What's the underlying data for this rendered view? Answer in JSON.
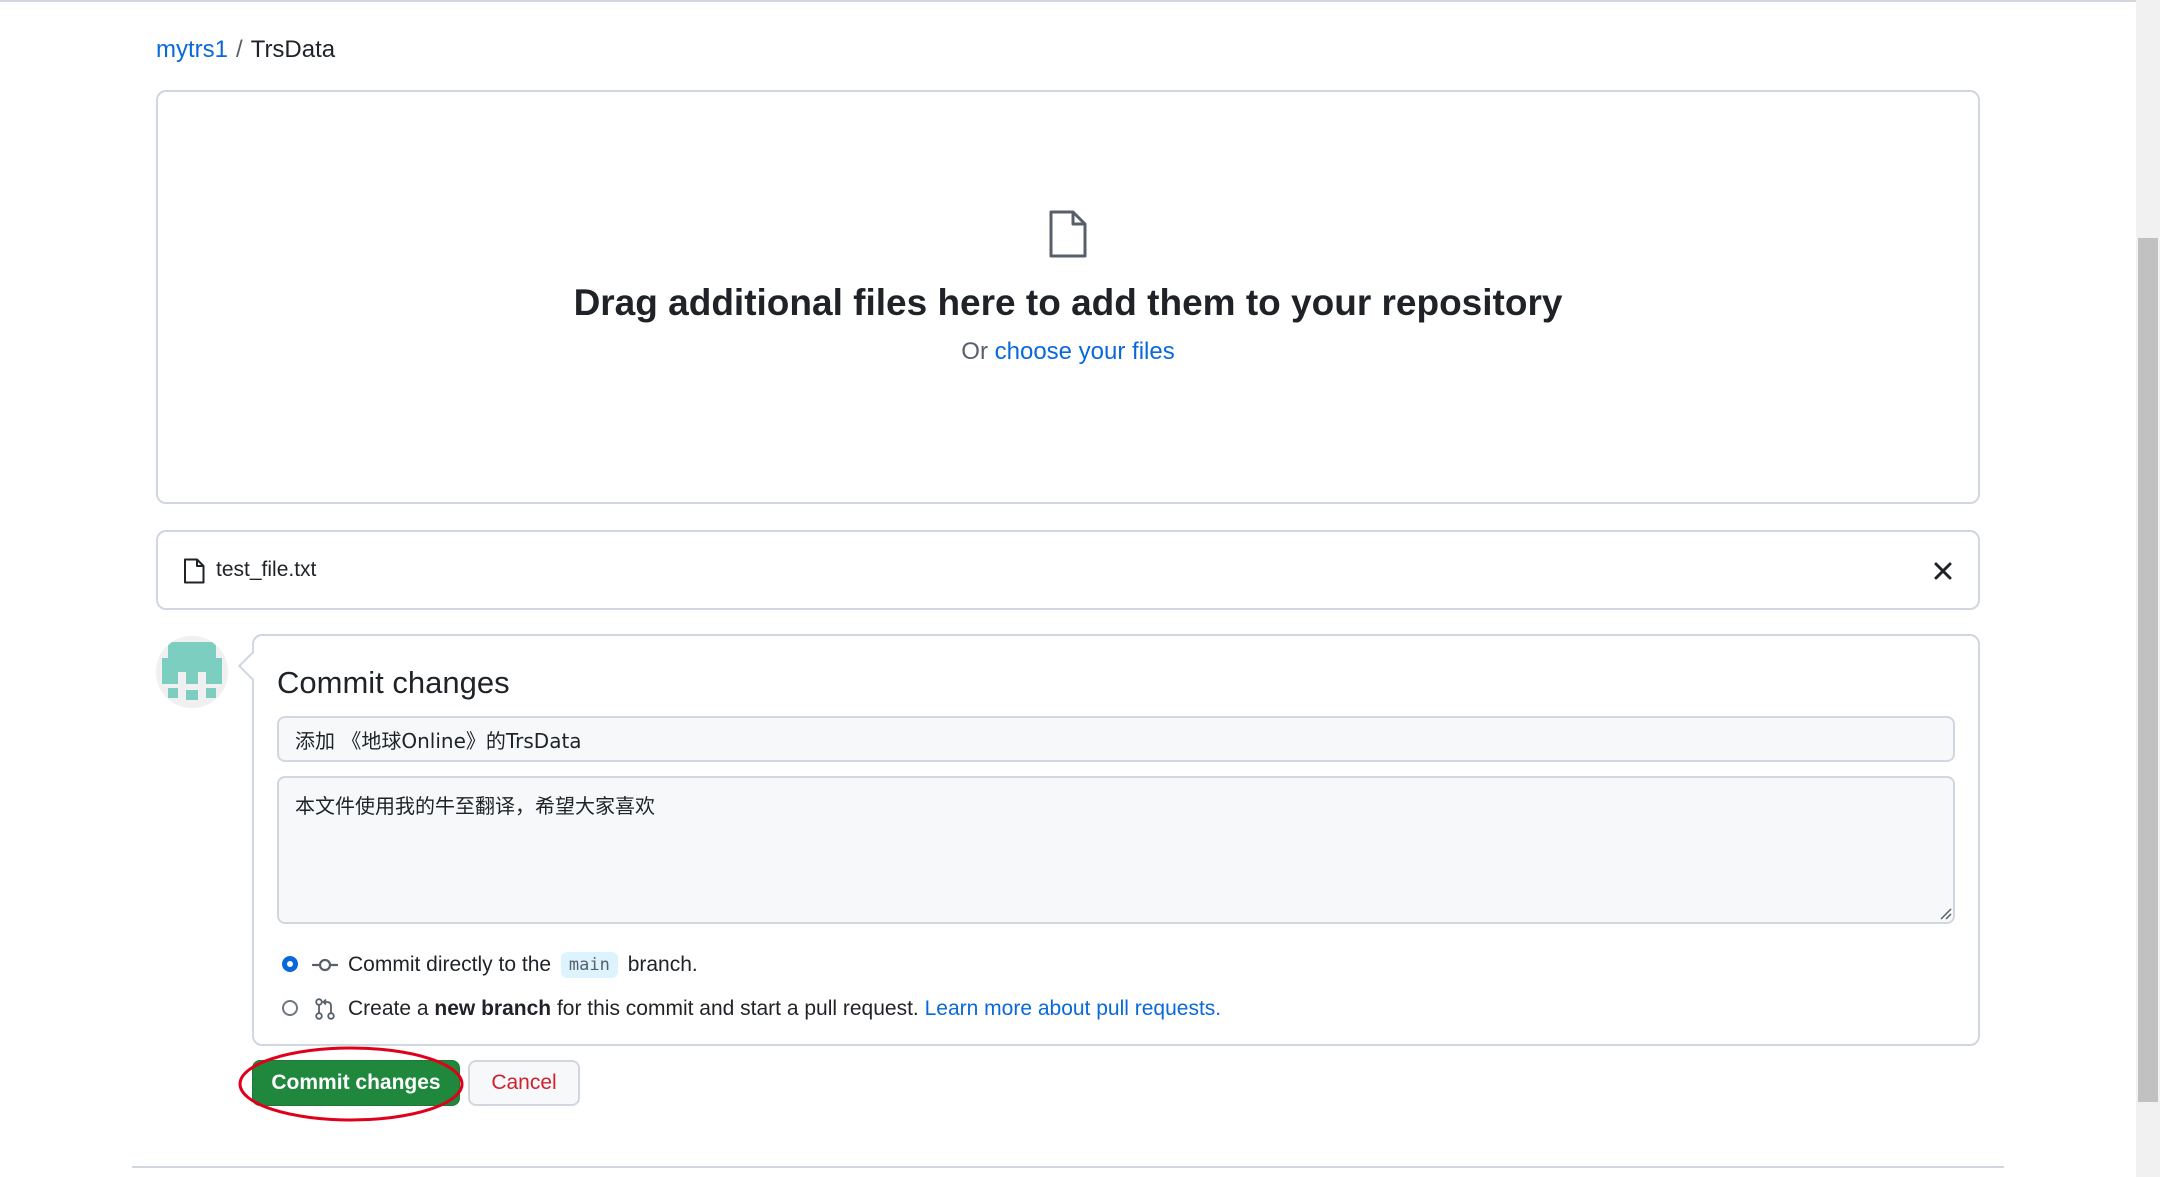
{
  "breadcrumb": {
    "owner": "mytrs1",
    "separator": "/",
    "repo": "TrsData"
  },
  "dropzone": {
    "icon": "file-icon",
    "title": "Drag additional files here to add them to your repository",
    "or_text": "Or",
    "choose_link": "choose your files"
  },
  "file": {
    "icon": "file-icon",
    "name": "test_file.txt",
    "remove_icon": "close-icon"
  },
  "commit": {
    "title": "Commit changes",
    "summary_value": "添加 《地球Online》的TrsData",
    "description_value": "本文件使用我的牛至翻译，希望大家喜欢",
    "option_direct": {
      "prefix": "Commit directly to the",
      "branch": "main",
      "suffix": "branch.",
      "selected": true,
      "icon": "git-commit-icon"
    },
    "option_new_branch": {
      "prefix": "Create a",
      "bold": "new branch",
      "middle": "for this commit and start a pull request.",
      "link": "Learn more about pull requests.",
      "selected": false,
      "icon": "git-pull-request-icon"
    },
    "commit_button": "Commit changes",
    "cancel_button": "Cancel"
  },
  "colors": {
    "link": "#0969da",
    "primary_button": "#1f883d",
    "cancel_text": "#cf222e",
    "annotation": "#e0001b",
    "border": "#d0d7de"
  }
}
